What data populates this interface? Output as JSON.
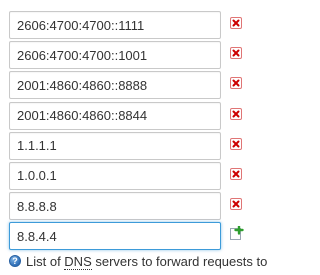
{
  "dns_servers": [
    {
      "value": "2606:4700:4700::1111",
      "action": "remove-icon"
    },
    {
      "value": "2606:4700:4700::1001",
      "action": "remove-icon"
    },
    {
      "value": "2001:4860:4860::8888",
      "action": "remove-icon"
    },
    {
      "value": "2001:4860:4860::8844",
      "action": "remove-icon"
    },
    {
      "value": "1.1.1.1",
      "action": "remove-icon"
    },
    {
      "value": "1.0.0.1",
      "action": "remove-icon"
    },
    {
      "value": "8.8.8.8",
      "action": "remove-icon"
    },
    {
      "value": "8.8.4.4",
      "action": "add-icon"
    }
  ],
  "help": {
    "icon": "help-icon",
    "icon_glyph": "?",
    "text_before": "List of ",
    "abbr": "DNS",
    "text_after": " servers to forward requests to"
  },
  "colors": {
    "remove": "#cc0000",
    "add": "#2e9e2e",
    "focus_border": "#3d9bd9",
    "help_icon": "#2f6fb7"
  }
}
